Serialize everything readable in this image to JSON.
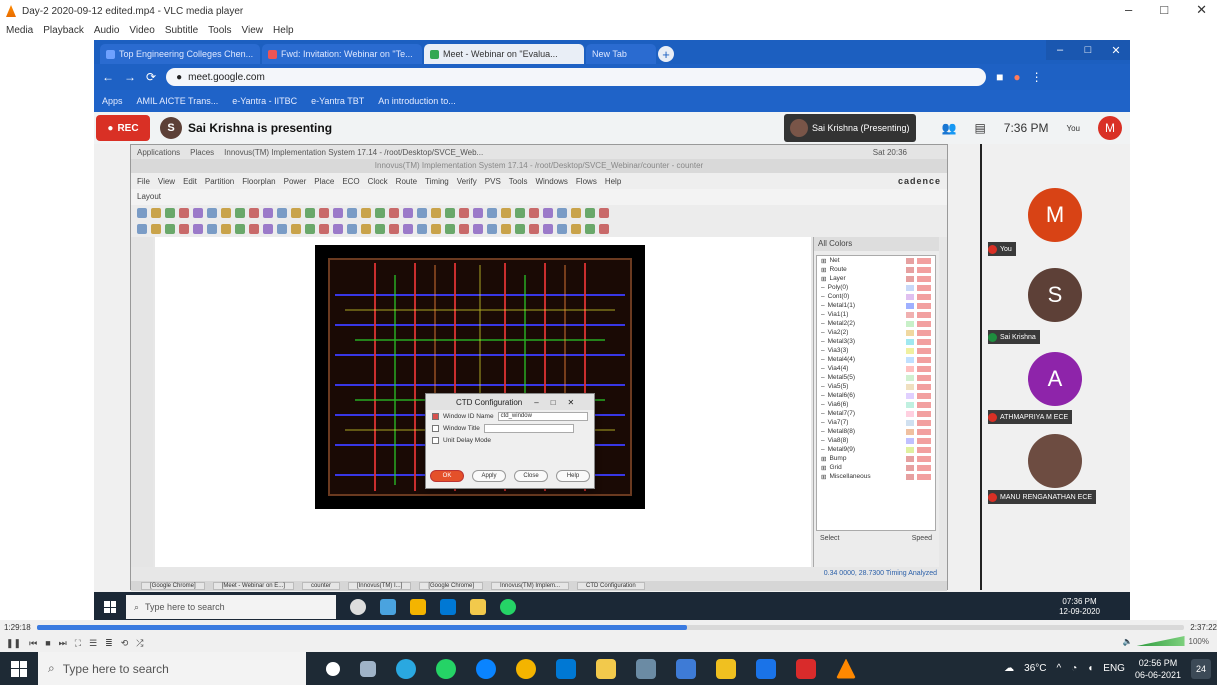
{
  "vlc": {
    "title": "Day-2 2020-09-12 edited.mp4 - VLC media player",
    "menu": [
      "Media",
      "Playback",
      "Audio",
      "Video",
      "Subtitle",
      "Tools",
      "View",
      "Help"
    ],
    "win_buttons": [
      "–",
      "□",
      "✕"
    ]
  },
  "browser": {
    "tabs": [
      {
        "label": "Top Engineering Colleges Chen...",
        "active": false
      },
      {
        "label": "Fwd: Invitation: Webinar on \"Te...",
        "active": false
      },
      {
        "label": "Meet - Webinar on \"Evalua...",
        "active": true
      },
      {
        "label": "New Tab",
        "active": false
      }
    ],
    "url": "meet.google.com",
    "bookmarks": [
      "Apps",
      "AMIL AICTE Trans...",
      "e-Yantra - IITBC",
      "e-Yantra TBT",
      "An introduction to..."
    ]
  },
  "meet": {
    "rec_label": "REC",
    "presenter": "Sai Krishna is presenting",
    "presenter_chip": "Sai Krishna (Presenting)",
    "clock": "7:36 PM",
    "you_label": "You",
    "you_initial": "M"
  },
  "vm": {
    "top_items": [
      "Applications",
      "Places",
      "Innovus(TM) Implementation System 17.14 - /root/Desktop/SVCE_Web..."
    ],
    "datetime": "Sat 20:36",
    "app_title": "Innovus(TM) Implementation System 17.14 - /root/Desktop/SVCE_Webinar/counter - counter",
    "menu": [
      "File",
      "View",
      "Edit",
      "Partition",
      "Floorplan",
      "Power",
      "Place",
      "ECO",
      "Clock",
      "Route",
      "Timing",
      "Verify",
      "PVS",
      "Tools",
      "Windows",
      "Flows",
      "Help"
    ],
    "brand": "cadence",
    "layout_tab": "Layout",
    "status": "0.34 0000, 28.7300 Timing Analyzed"
  },
  "panel": {
    "head": "All Colors",
    "items": [
      {
        "label": "Net",
        "color": "#e6a0a0"
      },
      {
        "label": "Route",
        "color": "#e6a0a0"
      },
      {
        "label": "Layer",
        "color": "#e6a0a0"
      },
      {
        "label": "Poly(0)",
        "color": "#c8d8f8"
      },
      {
        "label": "Cont(0)",
        "color": "#e0c0f0"
      },
      {
        "label": "Metal1(1)",
        "color": "#9fb0ff"
      },
      {
        "label": "Via1(1)",
        "color": "#f0b0b0"
      },
      {
        "label": "Metal2(2)",
        "color": "#c8f0c8"
      },
      {
        "label": "Via2(2)",
        "color": "#f0d8a0"
      },
      {
        "label": "Metal3(3)",
        "color": "#a0e8f0"
      },
      {
        "label": "Via3(3)",
        "color": "#f0f0a0"
      },
      {
        "label": "Metal4(4)",
        "color": "#c0e0ff"
      },
      {
        "label": "Via4(4)",
        "color": "#ffc0c0"
      },
      {
        "label": "Metal5(5)",
        "color": "#d0f0d0"
      },
      {
        "label": "Via5(5)",
        "color": "#f0e0c0"
      },
      {
        "label": "Metal6(6)",
        "color": "#e0d0ff"
      },
      {
        "label": "Via6(6)",
        "color": "#c0f0e0"
      },
      {
        "label": "Metal7(7)",
        "color": "#ffd0e0"
      },
      {
        "label": "Via7(7)",
        "color": "#d0e0f0"
      },
      {
        "label": "Metal8(8)",
        "color": "#f0c0a0"
      },
      {
        "label": "Via8(8)",
        "color": "#c0c0ff"
      },
      {
        "label": "Metal9(9)",
        "color": "#e0f0a0"
      },
      {
        "label": "Bump",
        "color": "#e6a0a0"
      },
      {
        "label": "Grid",
        "color": "#e6a0a0"
      },
      {
        "label": "Miscellaneous",
        "color": "#e6a0a0"
      }
    ],
    "foot_left": "Select",
    "foot_right": "Speed"
  },
  "dialog": {
    "title": "CTD Configuration",
    "rows": [
      {
        "label": "Window ID Name",
        "value": "ctd_window",
        "checked": true
      },
      {
        "label": "Window Title",
        "value": "",
        "checked": false
      },
      {
        "label": "Unit Delay Mode",
        "value": "",
        "checked": false
      }
    ],
    "buttons": [
      "OK",
      "Apply",
      "Close",
      "Help"
    ]
  },
  "participants": [
    {
      "initial": "M",
      "color": "#d84315",
      "name": "You"
    },
    {
      "initial": "S",
      "color": "#5d4037",
      "name": "Sai Krishna"
    },
    {
      "initial": "A",
      "color": "#8e24aa",
      "name": "ATHMAPRIYA M ECE"
    },
    {
      "initial": "",
      "color": "#6d4c41",
      "name": "MANU RENGANATHAN ECE"
    }
  ],
  "rec_taskbar": {
    "search": "Type here to search",
    "time": "07:36 PM",
    "date": "12-09-2020",
    "windows": [
      "[Google Chrome]",
      "[Meet - Webinar on E...]",
      "counter",
      "[Innovus(TM) I...]",
      "[Google Chrome]",
      "Innovus(TM) Implem...",
      "CTD Configuration"
    ]
  },
  "player": {
    "elapsed": "1:29:18",
    "total": "2:37:22",
    "progress": 0.567,
    "volume_label": "100%"
  },
  "taskbar": {
    "search": "Type here to search",
    "weather": "36°C",
    "lang": "ENG",
    "time": "02:56 PM",
    "date": "06-06-2021",
    "notif_count": "24"
  }
}
